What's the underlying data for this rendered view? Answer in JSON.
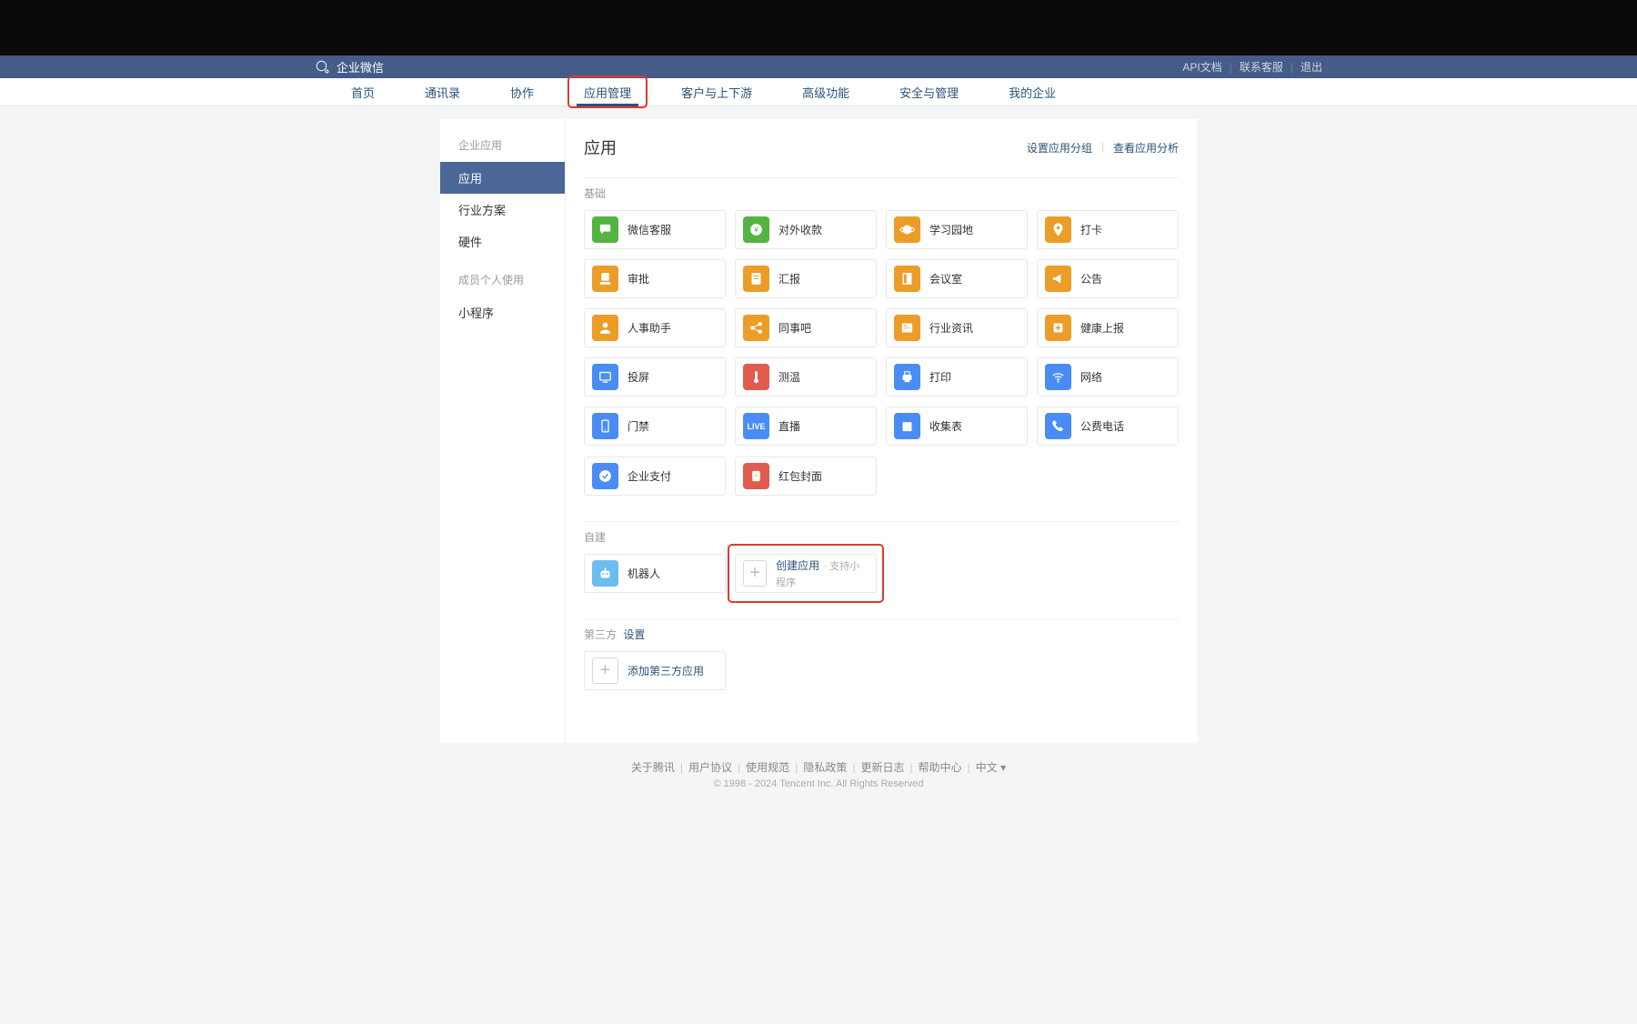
{
  "header": {
    "brand": "企业微信",
    "links": {
      "api": "API文档",
      "contact": "联系客服",
      "logout": "退出"
    }
  },
  "nav": {
    "items": [
      "首页",
      "通讯录",
      "协作",
      "应用管理",
      "客户与上下游",
      "高级功能",
      "安全与管理",
      "我的企业"
    ],
    "active": "应用管理"
  },
  "sidebar": {
    "group1_title": "企业应用",
    "group1_items": [
      "应用",
      "行业方案",
      "硬件"
    ],
    "group2_title": "成员个人使用",
    "group2_items": [
      "小程序"
    ],
    "active": "应用"
  },
  "main": {
    "title": "应用",
    "actions": {
      "group": "设置应用分组",
      "analysis": "查看应用分析"
    },
    "sections": {
      "basic": {
        "label": "基础",
        "apps": [
          {
            "name": "微信客服",
            "icon": "chat",
            "color": "ic-green"
          },
          {
            "name": "对外收款",
            "icon": "yen",
            "color": "ic-green"
          },
          {
            "name": "学习园地",
            "icon": "planet",
            "color": "ic-orange"
          },
          {
            "name": "打卡",
            "icon": "pin",
            "color": "ic-orange"
          },
          {
            "name": "审批",
            "icon": "stamp",
            "color": "ic-orange"
          },
          {
            "name": "汇报",
            "icon": "doc",
            "color": "ic-orange"
          },
          {
            "name": "会议室",
            "icon": "door",
            "color": "ic-orange"
          },
          {
            "name": "公告",
            "icon": "horn",
            "color": "ic-orange"
          },
          {
            "name": "人事助手",
            "icon": "person",
            "color": "ic-orange"
          },
          {
            "name": "同事吧",
            "icon": "share",
            "color": "ic-orange"
          },
          {
            "name": "行业资讯",
            "icon": "news",
            "color": "ic-orange"
          },
          {
            "name": "健康上报",
            "icon": "health",
            "color": "ic-orange"
          },
          {
            "name": "投屏",
            "icon": "cast",
            "color": "ic-blue"
          },
          {
            "name": "测温",
            "icon": "temp",
            "color": "ic-red"
          },
          {
            "name": "打印",
            "icon": "print",
            "color": "ic-blue"
          },
          {
            "name": "网络",
            "icon": "wifi",
            "color": "ic-blue"
          },
          {
            "name": "门禁",
            "icon": "mobile",
            "color": "ic-blue"
          },
          {
            "name": "直播",
            "icon": "live",
            "color": "ic-blue"
          },
          {
            "name": "收集表",
            "icon": "form",
            "color": "ic-blue"
          },
          {
            "name": "公费电话",
            "icon": "phone",
            "color": "ic-blue"
          }
        ],
        "apps2": [
          {
            "name": "企业支付",
            "icon": "pay",
            "color": "ic-blue"
          },
          {
            "name": "红包封面",
            "icon": "redpacket",
            "color": "ic-red"
          }
        ]
      },
      "custom": {
        "label": "自建",
        "apps": [
          {
            "name": "机器人",
            "icon": "robot",
            "color": "ic-lightblue"
          }
        ],
        "create": {
          "label": "创建应用",
          "sub": "· 支持小程序"
        }
      },
      "thirdparty": {
        "label": "第三方",
        "settings": "设置",
        "create": {
          "label": "添加第三方应用"
        }
      }
    }
  },
  "footer": {
    "links": [
      "关于腾讯",
      "用户协议",
      "使用规范",
      "隐私政策",
      "更新日志",
      "帮助中心",
      "中文 ▾"
    ],
    "copy": "© 1998 - 2024 Tencent Inc. All Rights Reserved"
  }
}
